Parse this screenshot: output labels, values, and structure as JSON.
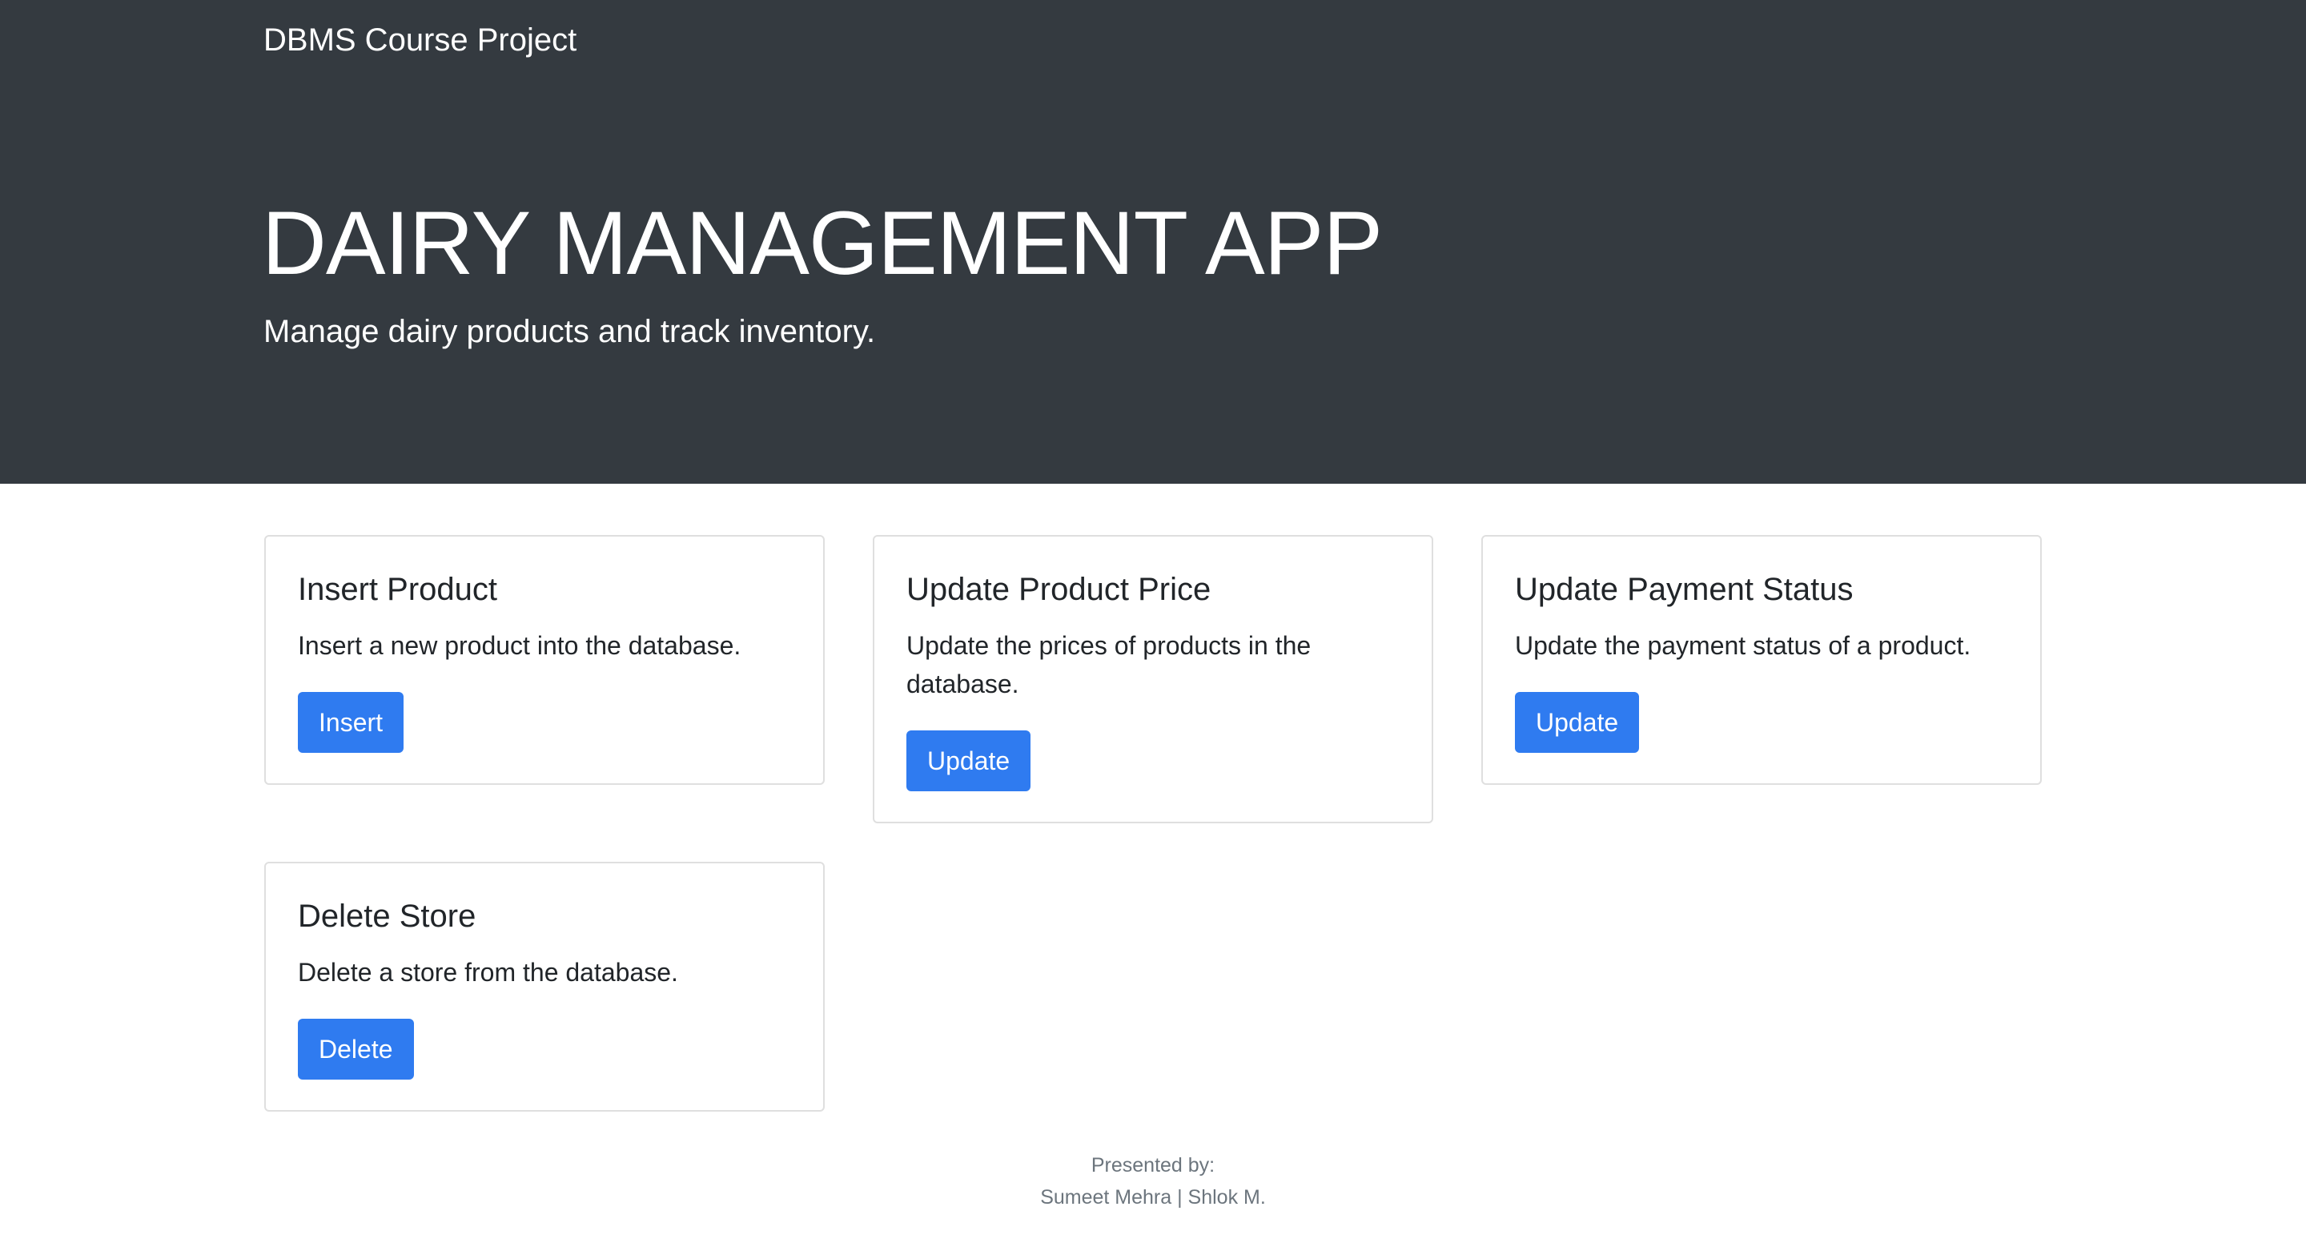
{
  "navbar": {
    "brand": "DBMS Course Project"
  },
  "hero": {
    "title": "DAIRY MANAGEMENT APP",
    "subtitle": "Manage dairy products and track inventory."
  },
  "cards": [
    {
      "title": "Insert Product",
      "text": "Insert a new product into the database.",
      "button": "Insert"
    },
    {
      "title": "Update Product Price",
      "text": "Update the prices of products in the database.",
      "button": "Update"
    },
    {
      "title": "Update Payment Status",
      "text": "Update the payment status of a product.",
      "button": "Update"
    },
    {
      "title": "Delete Store",
      "text": "Delete a store from the database.",
      "button": "Delete"
    }
  ],
  "footer": {
    "line1": "Presented by:",
    "line2": "Sumeet Mehra | Shlok M."
  },
  "colors": {
    "hero_background": "#343a40",
    "button_primary": "#2f7bf0",
    "card_border": "#dfdfdf",
    "footer_text": "#6c757d"
  }
}
